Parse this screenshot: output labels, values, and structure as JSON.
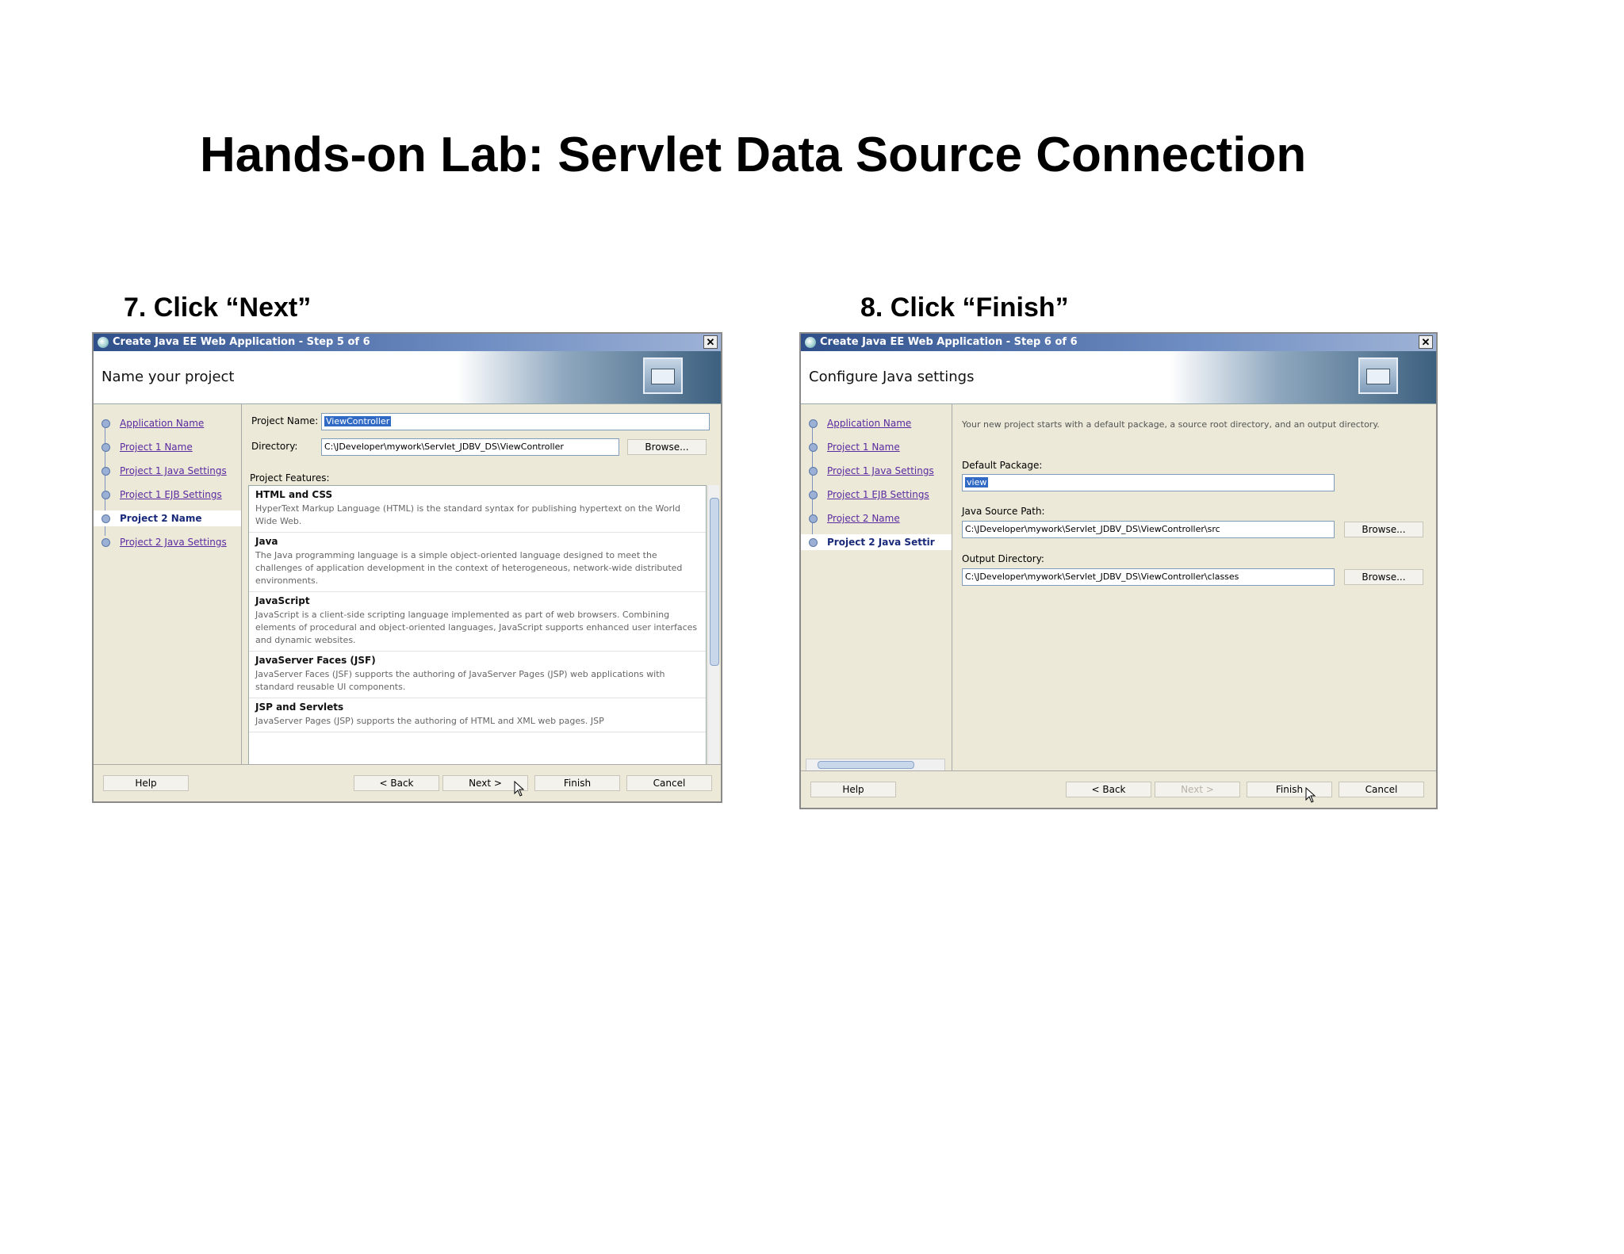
{
  "slide": {
    "title": "Hands-on Lab: Servlet Data Source Connection",
    "step7": "7. Click “Next”",
    "step8": "8. Click “Finish”"
  },
  "dialog1": {
    "window_title": "Create Java EE Web Application - Step 5 of 6",
    "header": "Name your project",
    "nav": [
      {
        "label": "Application Name",
        "state": "visited"
      },
      {
        "label": "Project 1 Name",
        "state": "visited"
      },
      {
        "label": "Project 1 Java Settings",
        "state": "visited"
      },
      {
        "label": "Project 1 EJB Settings",
        "state": "visited"
      },
      {
        "label": "Project 2 Name",
        "state": "current"
      },
      {
        "label": "Project 2 Java Settings",
        "state": "visited"
      }
    ],
    "project_name_label": "Project Name:",
    "project_name_value": "ViewController",
    "directory_label": "Directory:",
    "directory_value": "C:\\JDeveloper\\mywork\\Servlet_JDBV_DS\\ViewController",
    "browse_label": "Browse...",
    "features_label": "Project Features:",
    "features": [
      {
        "name": "HTML and CSS",
        "desc": "HyperText Markup Language (HTML) is the standard syntax for publishing hypertext on the World Wide Web."
      },
      {
        "name": "Java",
        "desc": "The Java programming language is a simple object-oriented language designed to meet the challenges of application development in the context of heterogeneous, network-wide distributed environments."
      },
      {
        "name": "JavaScript",
        "desc": "JavaScript is a client-side scripting language implemented as part of web browsers. Combining elements of procedural and object-oriented languages, JavaScript supports enhanced user interfaces and dynamic websites."
      },
      {
        "name": "JavaServer Faces (JSF)",
        "desc": "JavaServer Faces (JSF) supports the authoring of JavaServer Pages (JSP) web applications with standard reusable UI components."
      },
      {
        "name": "JSP and Servlets",
        "desc": "JavaServer Pages (JSP) supports the authoring of HTML and XML web pages. JSP"
      }
    ],
    "buttons": {
      "help": "Help",
      "back": "< Back",
      "next": "Next >",
      "finish": "Finish",
      "cancel": "Cancel"
    }
  },
  "dialog2": {
    "window_title": "Create Java EE Web Application - Step 6 of 6",
    "header": "Configure Java settings",
    "nav": [
      {
        "label": "Application Name",
        "state": "visited"
      },
      {
        "label": "Project 1 Name",
        "state": "visited"
      },
      {
        "label": "Project 1 Java Settings",
        "state": "visited"
      },
      {
        "label": "Project 1 EJB Settings",
        "state": "visited"
      },
      {
        "label": "Project 2 Name",
        "state": "visited"
      },
      {
        "label": "Project 2 Java Settir",
        "state": "current"
      }
    ],
    "info": "Your new project starts with a default package, a source root directory, and an output directory.",
    "default_package_label": "Default Package:",
    "default_package_value": "view",
    "java_source_label": "Java Source Path:",
    "java_source_value": "C:\\JDeveloper\\mywork\\Servlet_JDBV_DS\\ViewController\\src",
    "output_dir_label": "Output Directory:",
    "output_dir_value": "C:\\JDeveloper\\mywork\\Servlet_JDBV_DS\\ViewController\\classes",
    "browse_label": "Browse...",
    "buttons": {
      "help": "Help",
      "back": "< Back",
      "next": "Next >",
      "finish": "Finish",
      "cancel": "Cancel"
    }
  }
}
